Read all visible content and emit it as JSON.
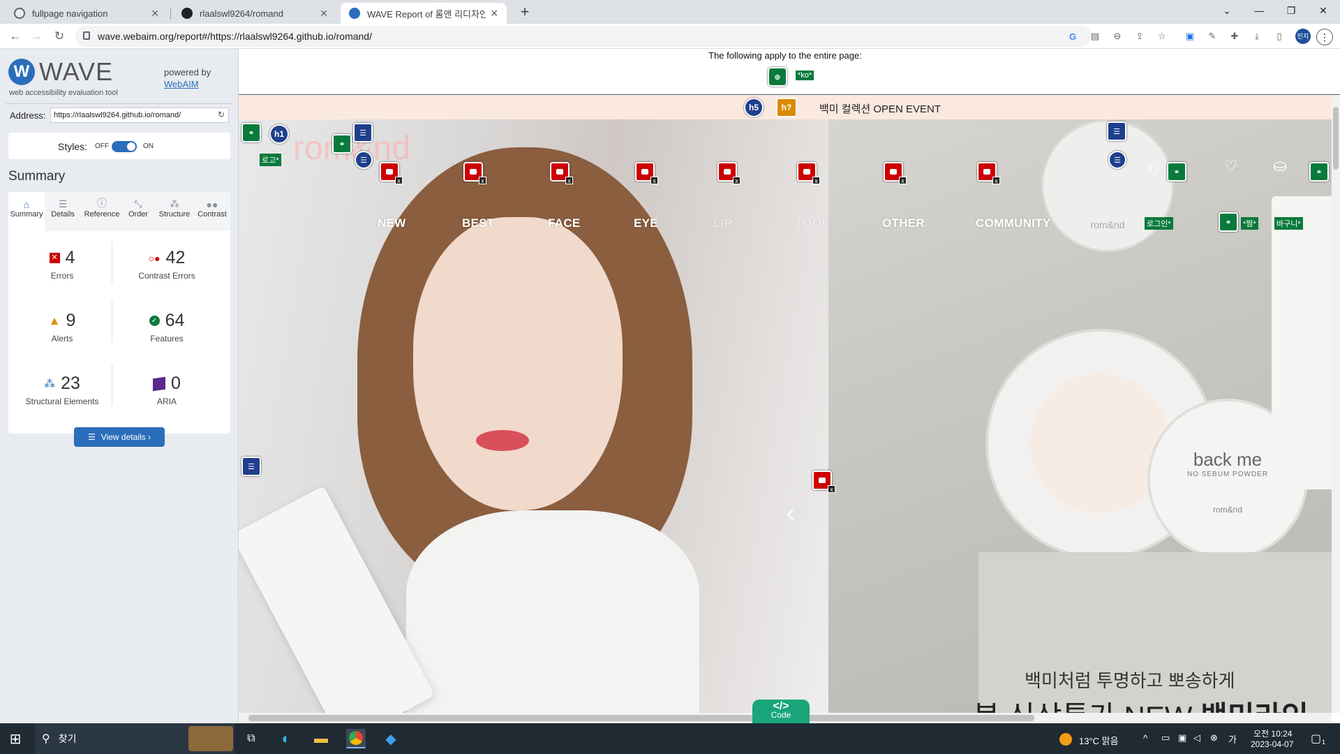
{
  "tabs": [
    {
      "title": "fullpage navigation",
      "active": false,
      "icon": "globe-icon"
    },
    {
      "title": "rlaalswl9264/romand",
      "active": false,
      "icon": "github-icon"
    },
    {
      "title": "WAVE Report of 롬앤 리디자인",
      "active": true,
      "icon": "wave-icon"
    }
  ],
  "toolbar": {
    "url": "wave.webaim.org/report#/https://rlaalswl9264.github.io/romand/",
    "profile": "민지"
  },
  "wave": {
    "logo": "WAVE",
    "tagline": "web accessibility evaluation tool",
    "powered_by": "powered by",
    "webaim": "WebAIM",
    "address_label": "Address:",
    "address_value": "https://rlaalswl9264.github.io/romand/",
    "styles_label": "Styles:",
    "styles_off": "OFF",
    "styles_on": "ON",
    "summary_title": "Summary",
    "panel_tabs": [
      "Summary",
      "Details",
      "Reference",
      "Order",
      "Structure",
      "Contrast"
    ],
    "counts": {
      "errors": {
        "value": "4",
        "label": "Errors"
      },
      "contrast": {
        "value": "42",
        "label": "Contrast Errors"
      },
      "alerts": {
        "value": "9",
        "label": "Alerts"
      },
      "features": {
        "value": "64",
        "label": "Features"
      },
      "structural": {
        "value": "23",
        "label": "Structural Elements"
      },
      "aria": {
        "value": "0",
        "label": "ARIA"
      }
    },
    "view_details": "View details ›"
  },
  "page": {
    "apply_text": "The following apply to the entire page:",
    "lang_badge": "*ko*",
    "event_banner": "백미 컬렉션 OPEN EVENT",
    "h5": "h5",
    "h_unknown": "h?",
    "h1": "h1",
    "logo_alt": "로고*",
    "brand_bg": "rom&nd",
    "nav": [
      "NEW",
      "BEST",
      "FACE",
      "EYE",
      "LIP",
      "TOOL",
      "OTHER",
      "COMMUNITY"
    ],
    "login_alt": "로그인*",
    "wish_alt": "*찜*",
    "cart_alt": "바구니*",
    "headline_small": "백미처럼 투명하고 뽀송하게",
    "headline_big_pre": "봄 신상특가 NEW ",
    "headline_big_bold": "백미라인",
    "product_brand": "rom&nd",
    "product_line1": "back me",
    "product_line2": "NO SEBUM POWDER",
    "code_tab": "Code"
  },
  "taskbar": {
    "search": "찾기",
    "weather": "13°C  맑음",
    "time": "오전 10:24",
    "date": "2023-04-07",
    "notify": "1"
  },
  "colors": {
    "wave_blue": "#2a6ebb",
    "error": "#cc0000",
    "feature": "#0a7a3c",
    "struct": "#1e3f8c",
    "code_tab": "#1aa67a"
  }
}
